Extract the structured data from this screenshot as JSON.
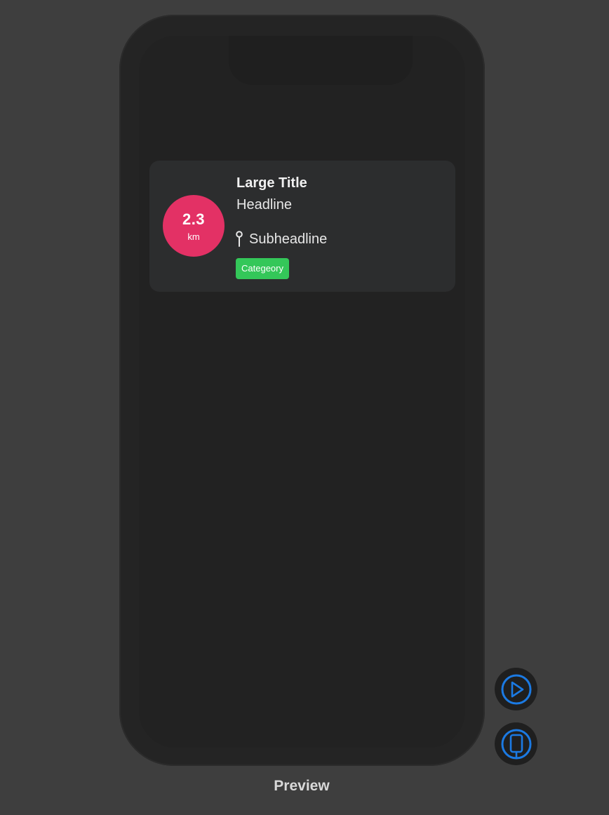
{
  "card": {
    "distance_value": "2.3",
    "distance_unit": "km",
    "title": "Large Title",
    "headline": "Headline",
    "subheadline": "Subheadline",
    "category": "Categeory",
    "location_icon": "pin-icon"
  },
  "controls": {
    "play_icon": "play-icon",
    "device_icon": "device-icon"
  },
  "footer": {
    "label": "Preview"
  },
  "colors": {
    "background": "#3e3e3e",
    "card": "#2c2d2e",
    "distance_badge": "#e33165",
    "category_tag": "#34c759",
    "control_accent": "#1b7ae3"
  }
}
